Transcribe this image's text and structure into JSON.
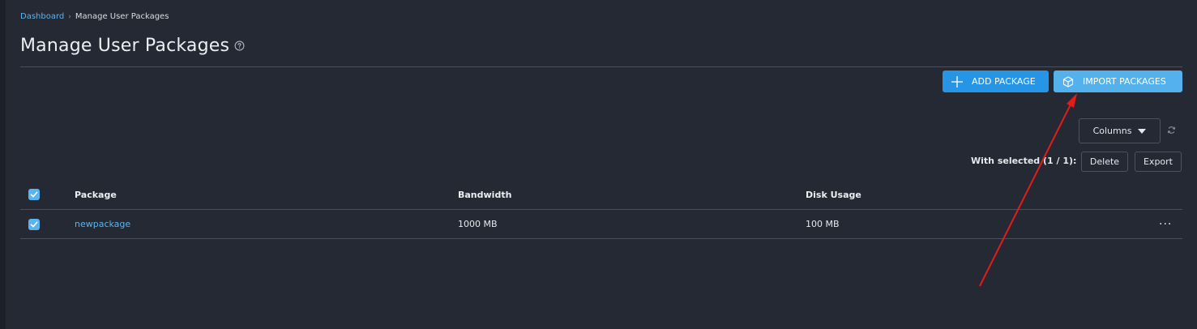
{
  "breadcrumb": {
    "home": "Dashboard",
    "separator": "›",
    "current": "Manage User Packages"
  },
  "page": {
    "title": "Manage User Packages",
    "help_icon": "question-circle-icon"
  },
  "toolbar": {
    "add_label": "ADD PACKAGE",
    "add_icon": "plus-icon",
    "import_label": "IMPORT PACKAGES",
    "import_icon": "box-icon"
  },
  "table_controls": {
    "columns_label": "Columns",
    "refresh_icon": "refresh-icon",
    "with_selected": "With selected (1 / 1):",
    "delete_label": "Delete",
    "export_label": "Export"
  },
  "table": {
    "columns": [
      "Package",
      "Bandwidth",
      "Disk Usage"
    ],
    "rows": [
      {
        "checked": true,
        "package": "newpackage",
        "bandwidth": "1000 MB",
        "disk_usage": "100 MB",
        "actions": "···"
      }
    ]
  },
  "colors": {
    "background": "#252933",
    "accent": "#2795e6",
    "accent_light": "#55b1ec",
    "link": "#5ab4f0",
    "annotation": "#e31b1b"
  }
}
